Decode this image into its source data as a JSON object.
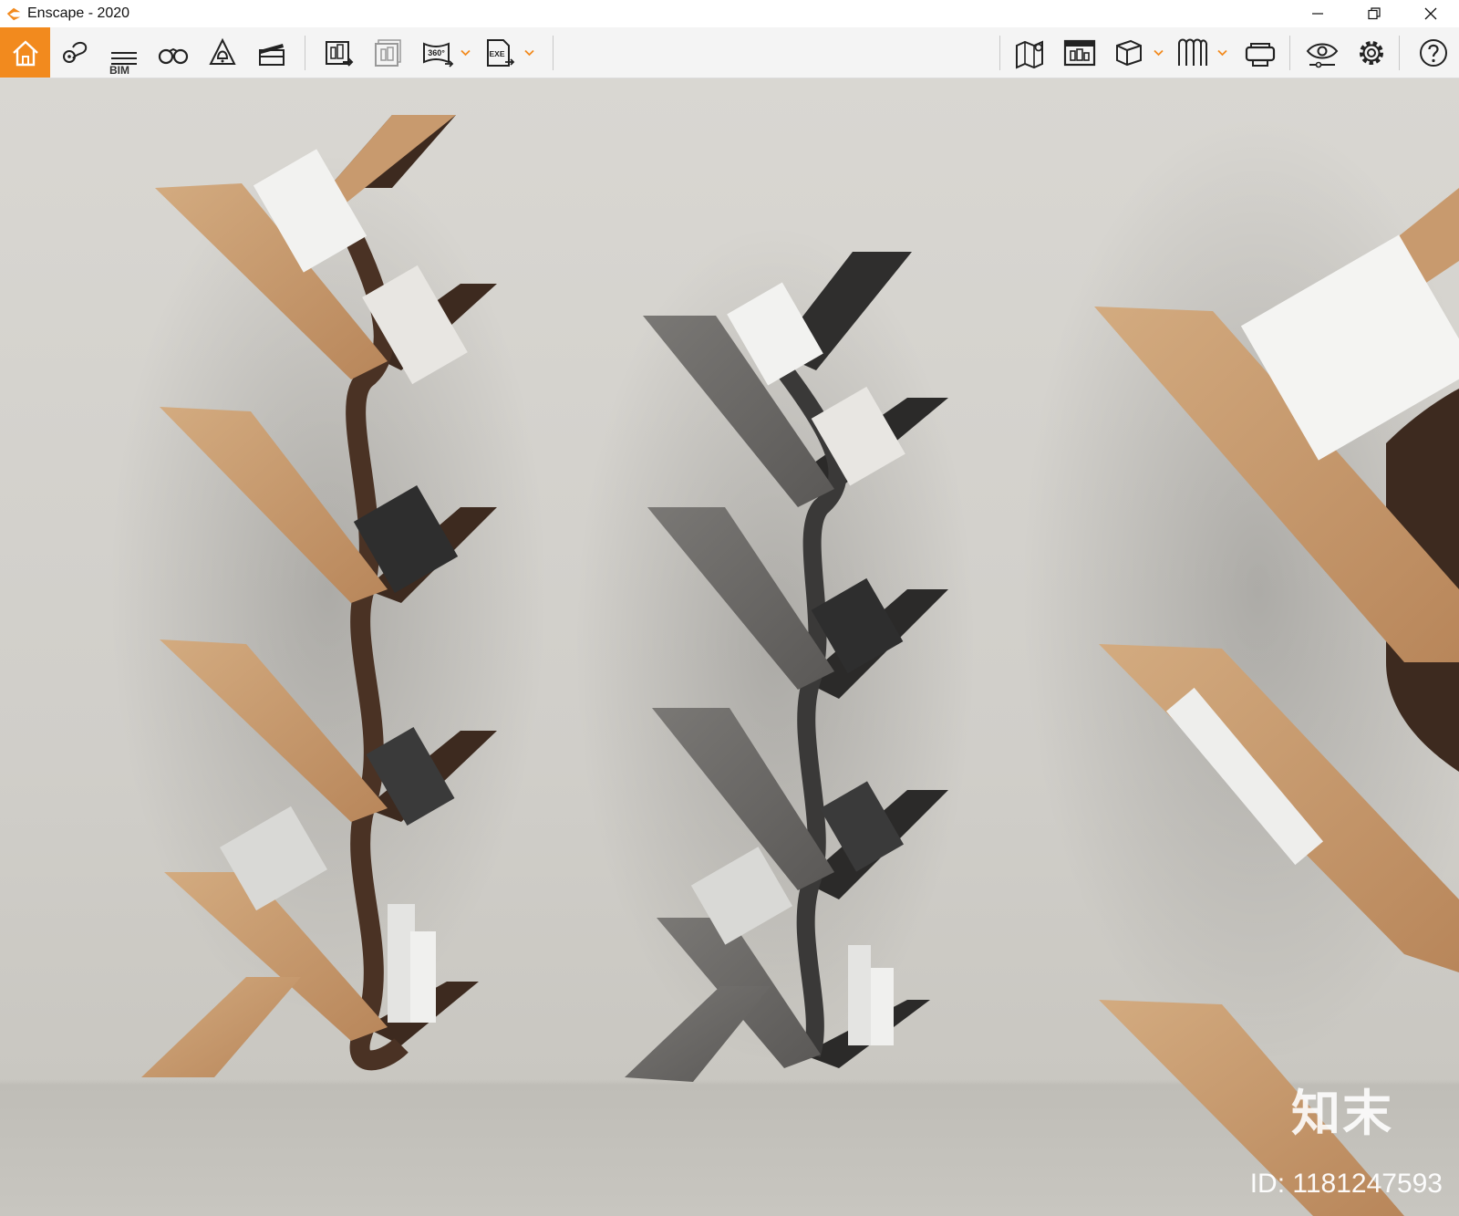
{
  "window": {
    "title": "Enscape - 2020",
    "accent_color": "#f28a1e"
  },
  "toolbar": {
    "bim_label": "BIM",
    "icons": [
      "home-icon",
      "location-pin-icon",
      "bim-list-icon",
      "binoculars-icon",
      "bell-icon",
      "clapboard-icon",
      "render-screenshot-icon",
      "batch-render-icon",
      "panorama-360-icon",
      "export-exe-icon",
      "map-icon",
      "asset-library-icon",
      "cube-view-icon",
      "vr-curtain-icon",
      "vr-headset-icon",
      "visual-settings-icon",
      "settings-gear-icon",
      "help-icon"
    ],
    "panorama_text": "360°",
    "exe_text": "EXE"
  },
  "watermark": {
    "logo_text": "知末",
    "id_text": "ID: 1181247593"
  }
}
